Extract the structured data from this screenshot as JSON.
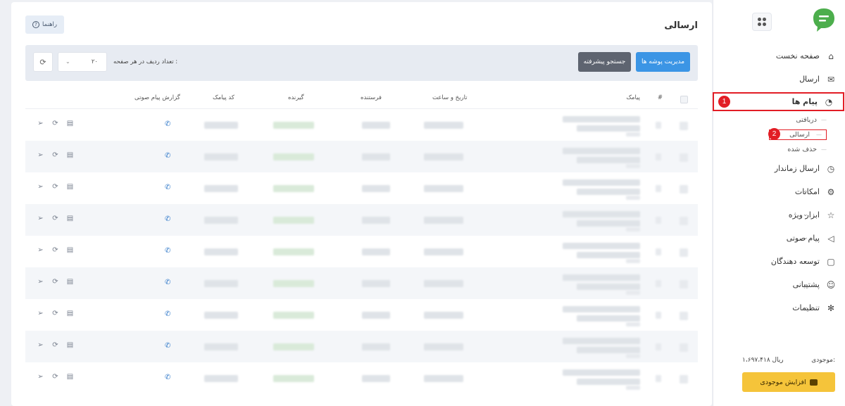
{
  "header": {
    "title": "ارسالی",
    "help_label": "راهنما"
  },
  "toolbar": {
    "folders_label": "مدیریت پوشه ها",
    "search_label": "جستجو پیشرفته",
    "rows_label": "تعداد ردیف در هر صفحه :",
    "rows_value": "۲۰"
  },
  "table": {
    "columns": {
      "index": "#",
      "message": "پیامک",
      "datetime": "تاریخ و ساعت",
      "sender": "فرستنده",
      "receiver": "گیرنده",
      "sms_code": "کد پیامک",
      "voice_report": "گزارش پیام صوتی"
    },
    "row_count": 9
  },
  "sidebar": {
    "items": [
      {
        "label": "صفحه نخست",
        "icon": "home-icon",
        "expandable": false
      },
      {
        "label": "ارسال",
        "icon": "send-mail-icon",
        "expandable": true
      },
      {
        "label": "پیام ها",
        "icon": "messages-icon",
        "expandable": true,
        "active": true,
        "children": [
          {
            "label": "دریافتی"
          },
          {
            "label": "ارسالی",
            "active": true
          },
          {
            "label": "حذف شده"
          }
        ]
      },
      {
        "label": "ارسال زماندار",
        "icon": "timer-icon",
        "expandable": true
      },
      {
        "label": "امکانات",
        "icon": "sliders-icon",
        "expandable": true
      },
      {
        "label": "ابزار ویژه",
        "icon": "star-icon",
        "expandable": true
      },
      {
        "label": "پیام صوتی",
        "icon": "speaker-icon",
        "expandable": true
      },
      {
        "label": "توسعه دهندگان",
        "icon": "terminal-icon",
        "expandable": true
      },
      {
        "label": "پشتیبانی",
        "icon": "support-icon",
        "expandable": true
      },
      {
        "label": "تنظیمات",
        "icon": "settings-icon",
        "expandable": true
      }
    ],
    "balance_label": "موجودی:",
    "balance_value": "۱،۶۹۷،۴۱۸ ریال",
    "topup_label": "افزایش موجودی"
  },
  "annotations": {
    "badge_1": "1",
    "badge_2": "2"
  },
  "colors": {
    "primary": "#3b95e5",
    "secondary": "#5e6470",
    "warning": "#f5c43a",
    "highlight": "#e21d25",
    "brand": "#4cae4c"
  }
}
